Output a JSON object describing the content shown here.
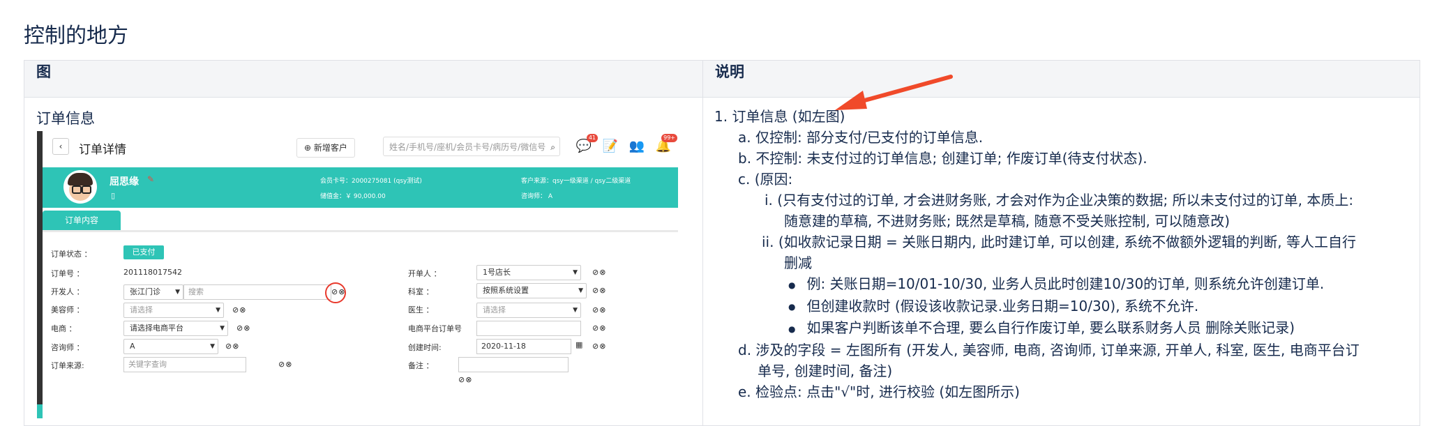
{
  "page_title": "控制的地方",
  "table": {
    "col_headers": [
      "图",
      "说明"
    ],
    "left_title": "订单信息"
  },
  "order_screen": {
    "back": "‹",
    "title": "订单详情",
    "add_customer": "⊕ 新增客户",
    "search_placeholder": "姓名/手机号/座机/会员卡号/病历号/微信号",
    "badge_messages": "41",
    "badge_notify": "99+",
    "customer": {
      "name": "屈思缘",
      "phone_icon": "▯",
      "member_card": "会员卡号：2000275081 (qsy测试)",
      "stored_value": "储值金：￥ 90,000.00",
      "source": "客户来源：qsy一级渠道 / qsy二级渠道",
      "consultant": "咨询师： A"
    },
    "tab": "订单内容",
    "fields": {
      "status_label": "订单状态 ：",
      "status_value": "已支付",
      "order_no_label": "订单号 ：",
      "order_no_value": "201118017542",
      "developer_label": "开发人 ：",
      "developer_value": "张江门诊",
      "developer_search": "搜索",
      "beautician_label": "美容师 ：",
      "beautician_value": "请选择",
      "ecommerce_label": "电商 ：",
      "ecommerce_value": "请选择电商平台",
      "consultant_label": "咨询师 ：",
      "consultant_value": "A",
      "source_label": "订单来源:",
      "source_placeholder": "关键字查询",
      "opener_label": "开单人 ：",
      "opener_value": "1号店长",
      "dept_label": "科室 ：",
      "dept_value": "按照系统设置",
      "doctor_label": "医生 ：",
      "doctor_value": "请选择",
      "platform_order_label": "电商平台订单号",
      "created_label": "创建时间:",
      "created_value": "2020-11-18",
      "remark_label": "备注 ："
    },
    "check_icons": "⊘⊗"
  },
  "instructions": {
    "item1": "1.  订单信息 (如左图)",
    "a": "a.  仅控制: 部分支付/已支付的订单信息.",
    "b": "b.  不控制: 未支付过的订单信息; 创建订单; 作废订单(待支付状态).",
    "c": "c.  (原因:",
    "c_i_1": "i.  (只有支付过的订单, 才会进财务账, 才会对作为企业决策的数据; 所以未支付过的订单, 本质上:",
    "c_i_2": "随意建的草稿, 不进财务账; 既然是草稿, 随意不受关账控制, 可以随意改)",
    "c_ii_1": "ii.  (如收款记录日期 = 关账日期内, 此时建订单, 可以创建, 系统不做额外逻辑的判断, 等人工自行",
    "c_ii_2": "删减",
    "bullet1": "例: 关账日期=10/01-10/30, 业务人员此时创建10/30的订单, 则系统允许创建订单.",
    "bullet2": "但创建收款时 (假设该收款记录.业务日期=10/30), 系统不允许.",
    "bullet3": "如果客户判断该单不合理, 要么自行作废订单, 要么联系财务人员  删除关账记录)",
    "d_1": "d.  涉及的字段 = 左图所有 (开发人, 美容师, 电商, 咨询师, 订单来源, 开单人, 科室, 医生, 电商平台订",
    "d_2": "单号, 创建时间, 备注)",
    "e": "e.  检验点: 点击\"√\"时, 进行校验 (如左图所示)"
  },
  "colors": {
    "teal": "#2ec4b6",
    "annotation_red": "#e8392c"
  }
}
